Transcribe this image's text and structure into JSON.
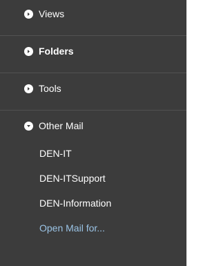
{
  "nav": {
    "sections": [
      {
        "label": "Views",
        "expanded": false,
        "icon": "chevron-right-icon"
      },
      {
        "label": "Folders",
        "expanded": false,
        "icon": "chevron-right-icon"
      },
      {
        "label": "Tools",
        "expanded": false,
        "icon": "chevron-right-icon"
      },
      {
        "label": "Other Mail",
        "expanded": true,
        "icon": "chevron-down-icon"
      }
    ],
    "other_mail_items": [
      "DEN-IT",
      "DEN-ITSupport",
      "DEN-Information"
    ],
    "open_mail_link": "Open Mail for..."
  },
  "colors": {
    "panel_bg": "#3c3c3c",
    "divider": "#525252",
    "text": "#ffffff",
    "link": "#9bc4e6"
  }
}
